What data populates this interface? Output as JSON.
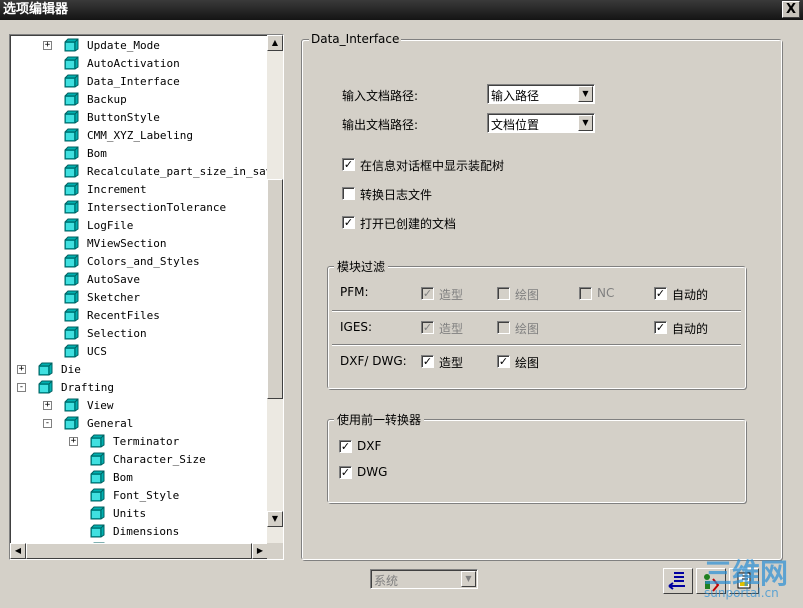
{
  "window": {
    "title": "选项编辑器",
    "close_glyph": "X"
  },
  "tree": {
    "rows": [
      {
        "label": "Update_Mode",
        "level": 1,
        "expander": "+"
      },
      {
        "label": "AutoActivation",
        "level": 1,
        "expander": ""
      },
      {
        "label": "Data_Interface",
        "level": 1,
        "expander": ""
      },
      {
        "label": "Backup",
        "level": 1,
        "expander": ""
      },
      {
        "label": "ButtonStyle",
        "level": 1,
        "expander": ""
      },
      {
        "label": "CMM_XYZ_Labeling",
        "level": 1,
        "expander": ""
      },
      {
        "label": "Bom",
        "level": 1,
        "expander": ""
      },
      {
        "label": "Recalculate_part_size_in_save",
        "level": 1,
        "expander": ""
      },
      {
        "label": "Increment",
        "level": 1,
        "expander": ""
      },
      {
        "label": "IntersectionTolerance",
        "level": 1,
        "expander": ""
      },
      {
        "label": "LogFile",
        "level": 1,
        "expander": ""
      },
      {
        "label": "MViewSection",
        "level": 1,
        "expander": ""
      },
      {
        "label": "Colors_and_Styles",
        "level": 1,
        "expander": ""
      },
      {
        "label": "AutoSave",
        "level": 1,
        "expander": ""
      },
      {
        "label": "Sketcher",
        "level": 1,
        "expander": ""
      },
      {
        "label": "RecentFiles",
        "level": 1,
        "expander": ""
      },
      {
        "label": "Selection",
        "level": 1,
        "expander": ""
      },
      {
        "label": "UCS",
        "level": 1,
        "expander": ""
      },
      {
        "label": "Die",
        "level": 0,
        "expander": "+"
      },
      {
        "label": "Drafting",
        "level": 0,
        "expander": "-"
      },
      {
        "label": "View",
        "level": 1,
        "expander": "+"
      },
      {
        "label": "General",
        "level": 1,
        "expander": "-"
      },
      {
        "label": "Terminator",
        "level": 2,
        "expander": "+"
      },
      {
        "label": "Character_Size",
        "level": 2,
        "expander": ""
      },
      {
        "label": "Bom",
        "level": 2,
        "expander": ""
      },
      {
        "label": "Font_Style",
        "level": 2,
        "expander": ""
      },
      {
        "label": "Units",
        "level": 2,
        "expander": ""
      },
      {
        "label": "Dimensions",
        "level": 2,
        "expander": ""
      },
      {
        "label": "",
        "level": 2,
        "expander": ""
      }
    ],
    "scroll_position": 0.5
  },
  "panel": {
    "title": "Data_Interface",
    "input_path_label": "输入文档路径:",
    "input_path_value": "输入路径",
    "output_path_label": "输出文档路径:",
    "output_path_value": "文档位置",
    "options": [
      {
        "label": "在信息对话框中显示装配树",
        "checked": true
      },
      {
        "label": "转换日志文件",
        "checked": false
      },
      {
        "label": "打开已创建的文档",
        "checked": true
      }
    ],
    "module_filter": {
      "title": "模块过滤",
      "pfm": {
        "label": "PFM:",
        "items": [
          {
            "label": "造型",
            "checked": true,
            "disabled": true
          },
          {
            "label": "绘图",
            "checked": false,
            "disabled": true
          },
          {
            "label": "NC",
            "checked": false,
            "disabled": true
          },
          {
            "label": "自动的",
            "checked": true,
            "disabled": false
          }
        ]
      },
      "iges": {
        "label": "IGES:",
        "items": [
          {
            "label": "造型",
            "checked": true,
            "disabled": true
          },
          {
            "label": "绘图",
            "checked": false,
            "disabled": true
          },
          {
            "label": "自动的",
            "checked": true,
            "disabled": false
          }
        ]
      },
      "dxf": {
        "label": "DXF/ DWG:",
        "items": [
          {
            "label": "造型",
            "checked": true,
            "disabled": false
          },
          {
            "label": "绘图",
            "checked": true,
            "disabled": false
          }
        ]
      }
    },
    "previous_converter": {
      "title": "使用前一转换器",
      "items": [
        {
          "label": "DXF",
          "checked": true
        },
        {
          "label": "DWG",
          "checked": true
        }
      ]
    }
  },
  "footer": {
    "scope_value": "系统",
    "buttons": [
      "apply-icon",
      "reset-icon",
      "export-icon"
    ]
  },
  "watermark": {
    "text1": "三维网",
    "text2": "sunportal.cn"
  },
  "colors": {
    "titlebar": "#141414",
    "face": "#d4d0c8",
    "folder_icon": "#00a0a0",
    "watermark": "#2a8fd6"
  }
}
